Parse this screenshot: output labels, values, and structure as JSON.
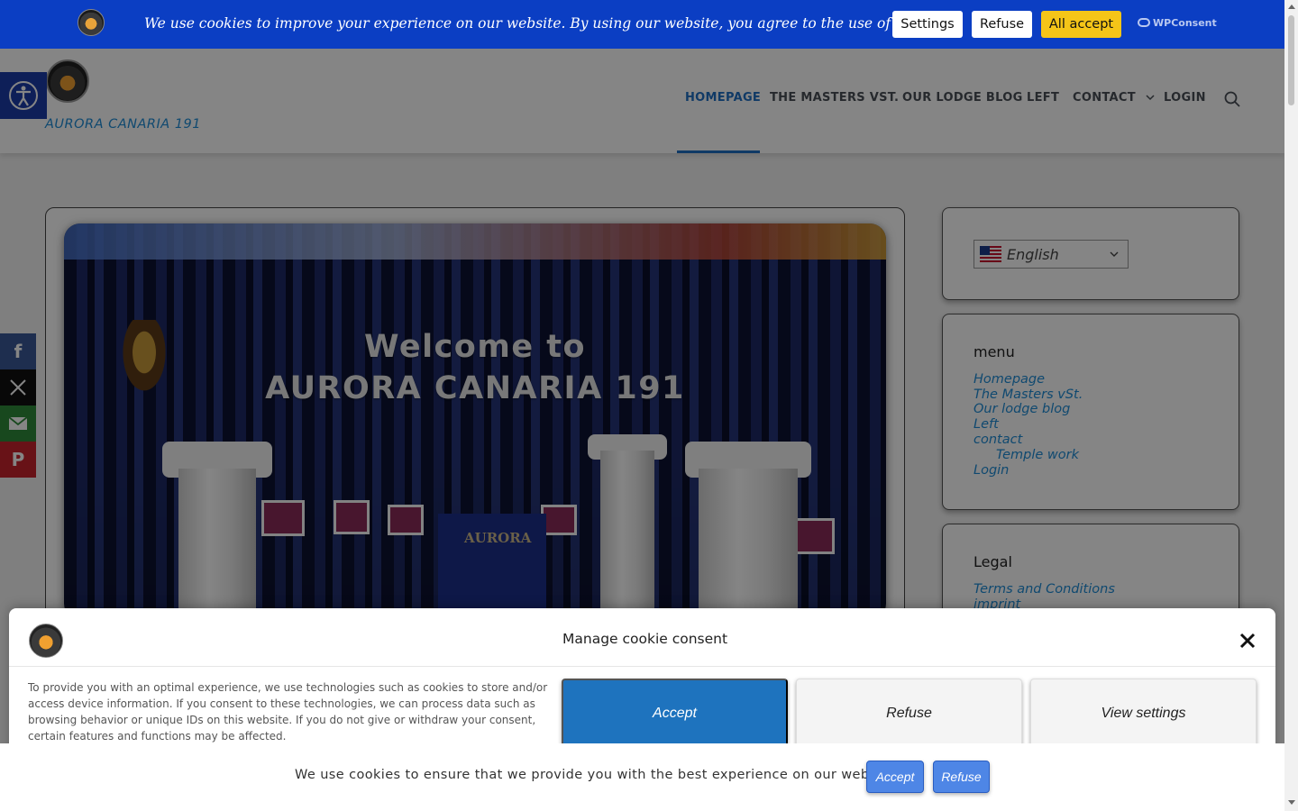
{
  "cookie_bar": {
    "text": "We use cookies to improve your experience on our website. By using our website, you agree to the use of cookies.",
    "settings_label": "Settings",
    "refuse_label": "Refuse",
    "accept_label": "All accept",
    "brand": "WPConsent",
    "bg_color": "#0b3ec3",
    "accept_color": "#f5c518"
  },
  "site": {
    "title": "AURORA CANARIA 191"
  },
  "nav": {
    "items": [
      {
        "label": "HOMEPAGE",
        "active": true
      },
      {
        "label": "THE MASTERS VST.",
        "active": false
      },
      {
        "label": "OUR LODGE BLOG",
        "active": false
      },
      {
        "label": "LEFT",
        "active": false
      },
      {
        "label": "CONTACT",
        "active": false,
        "has_dropdown": true
      },
      {
        "label": "LOGIN",
        "active": false
      }
    ],
    "accent_color": "#1f6fc4"
  },
  "hero": {
    "title_line1": "Welcome to",
    "title_line2": "AURORA CANARIA 191",
    "desk_label": "AURORA"
  },
  "social": [
    "facebook-icon",
    "x-icon",
    "mail-icon",
    "pinterest-icon"
  ],
  "sidebar": {
    "language": "English",
    "menu_title": "menu",
    "menu_items": [
      "Homepage",
      "The Masters vSt.",
      "Our lodge blog",
      "Left",
      "contact",
      "Temple work",
      "Login"
    ],
    "legal_title": "Legal",
    "legal_items": [
      "Terms and Conditions",
      "imprint"
    ]
  },
  "consent_modal": {
    "title": "Manage cookie consent",
    "text": "To provide you with an optimal experience, we use technologies such as cookies to store and/or access device information. If you consent to these technologies, we can process data such as browsing behavior or unique IDs on this website. If you do not give or withdraw your consent, certain features and functions may be affected.",
    "accept_label": "Accept",
    "refuse_label": "Refuse",
    "view_label": "View settings"
  },
  "notice_bar": {
    "text": "We use cookies to ensure that we provide you with the best experience on our website.",
    "accept_label": "Accept",
    "refuse_label": "Refuse"
  }
}
